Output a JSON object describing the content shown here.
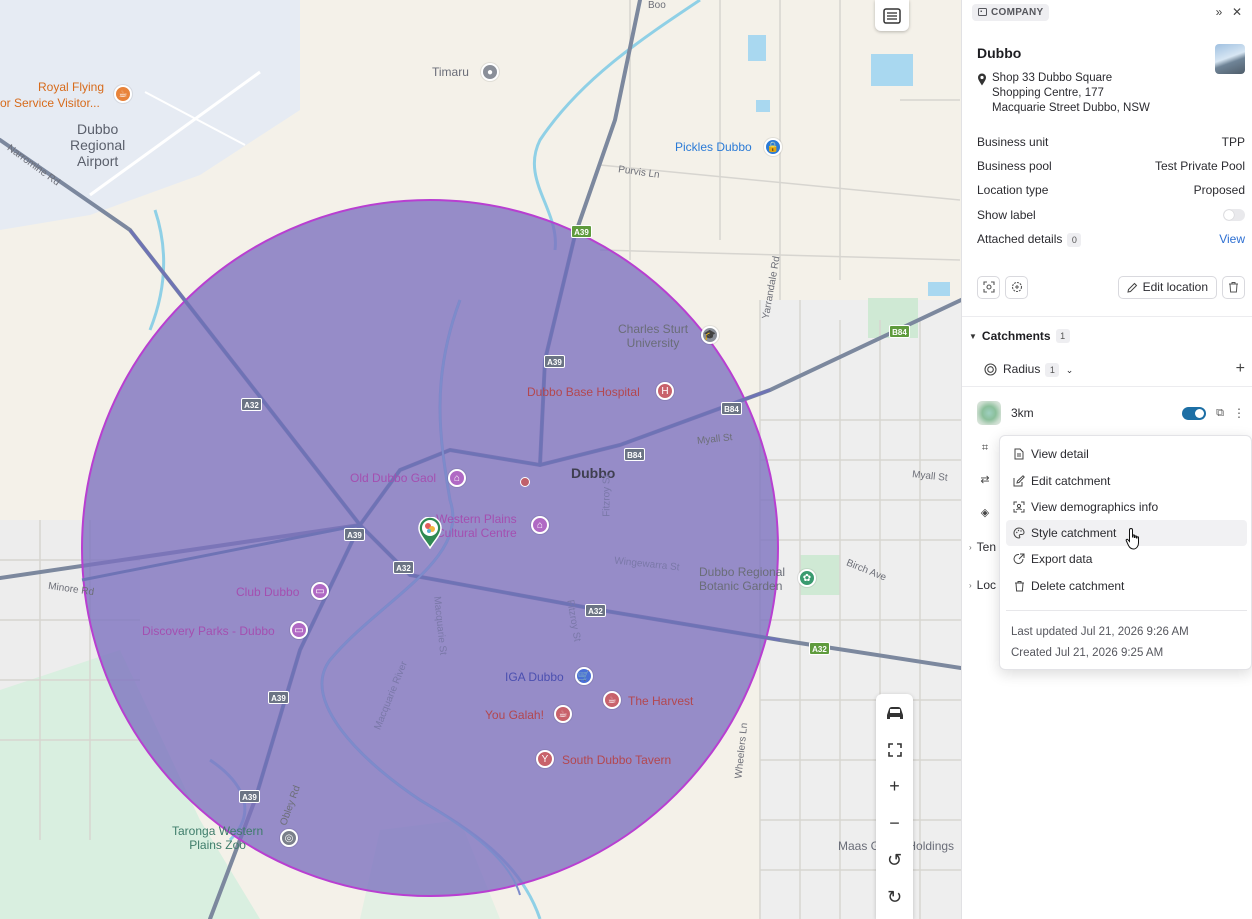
{
  "map": {
    "labels": {
      "royal_flying": "Royal Flying",
      "service_visitor": "or Service Visitor...",
      "airport": "Dubbo\nRegional\nAirport",
      "timaru": "Timaru",
      "pickles": "Pickles Dubbo",
      "purvis": "Purvis Ln",
      "charles_sturt": "Charles Sturt\nUniversity",
      "hospital": "Dubbo Base Hospital",
      "old_gaol": "Old Dubbo Gaol",
      "dubbo": "Dubbo",
      "western_plains": "Western Plains\nCultural Centre",
      "club_dubbo": "Club Dubbo",
      "discovery": "Discovery Parks - Dubbo",
      "iga": "IGA Dubbo",
      "harvest": "The Harvest",
      "you_galah": "You Galah!",
      "tavern": "South Dubbo Tavern",
      "botanic": "Dubbo Regional\nBotanic Garden",
      "birch": "Birch Ave",
      "myall1": "Myall St",
      "myall2": "Myall St",
      "wingewarra": "Wingewarra St",
      "minore": "Minore Rd",
      "narromine": "Narromine Rd",
      "taronga": "Taronga Western\nPlains Zoo",
      "maas": "Maas Group Holdings",
      "fitzroy1": "Fitzroy St",
      "fitzroy2": "Fitzroy St",
      "macquarie_st": "Macquarie St",
      "yarrandale": "Yarrandale Rd",
      "wheelers": "Wheelers Ln",
      "macquarie_river": "Macquarie River",
      "obley": "Obley Rd",
      "boo": "Boo"
    },
    "shields": {
      "a39_top": "A39",
      "a39_mid": "A39",
      "a32_left": "A32",
      "b84_right": "B84",
      "b84_top": "B84",
      "b84_mid": "B84",
      "a39_left": "A39",
      "a32_center": "A32",
      "a32_east": "A32",
      "a32_far": "A32",
      "a39_south": "A39",
      "a39_bottom": "A39"
    },
    "catchment_fill": "#7b6fbf",
    "catchment_stroke": "#b83fd1"
  },
  "panel": {
    "badge": "COMPANY",
    "title": "Dubbo",
    "address": [
      "Shop 33 Dubbo Square",
      "Shopping Centre, 177",
      "Macquarie Street Dubbo, NSW"
    ],
    "fields": {
      "business_unit": {
        "label": "Business unit",
        "value": "TPP"
      },
      "business_pool": {
        "label": "Business pool",
        "value": "Test Private Pool"
      },
      "location_type": {
        "label": "Location type",
        "value": "Proposed"
      },
      "show_label": {
        "label": "Show label"
      },
      "attached": {
        "label": "Attached details",
        "count": "0",
        "link": "View"
      }
    },
    "edit_location": "Edit location",
    "catchments": {
      "label": "Catchments",
      "count": "1"
    },
    "radius": {
      "label": "Radius",
      "count": "1"
    },
    "item": {
      "label": "3km"
    },
    "sections": {
      "ten": "Ten",
      "loc": "Loc"
    }
  },
  "menu": {
    "items": [
      "View detail",
      "Edit catchment",
      "View demographics info",
      "Style catchment",
      "Export data",
      "Delete catchment"
    ],
    "last_updated": "Last updated Jul 21, 2026 9:26 AM",
    "created": "Created Jul 21, 2026 9:25 AM"
  }
}
